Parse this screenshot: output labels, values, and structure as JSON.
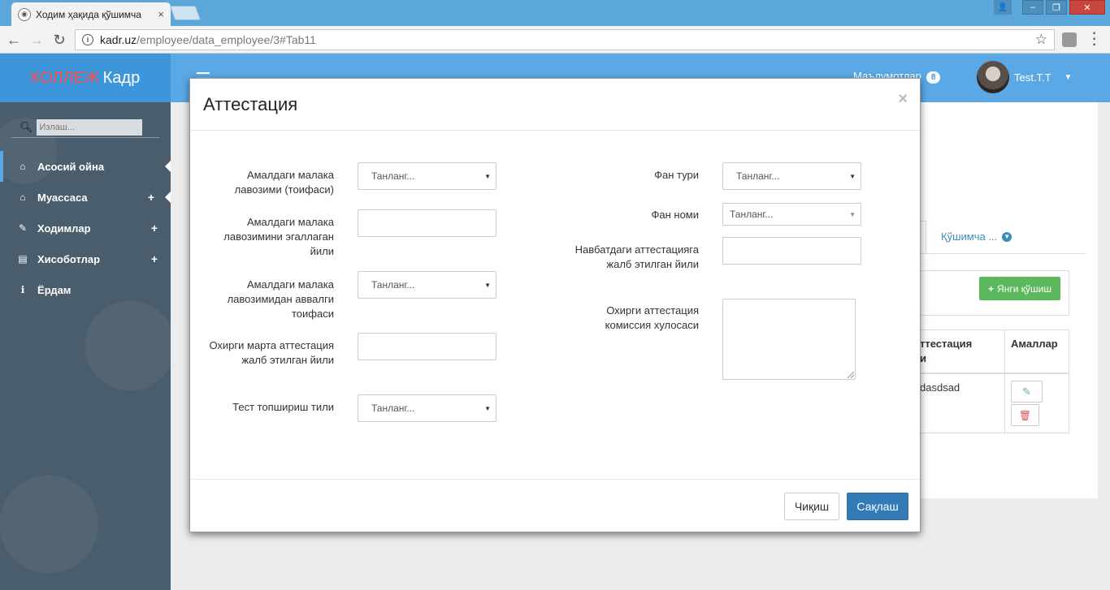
{
  "browser": {
    "tab_title": "Ходим ҳақида қўшимча",
    "url_host": "kadr.uz",
    "url_path": "/employee/data_employee/3#Tab11"
  },
  "header": {
    "logo_red": "КОЛЛЕЖ",
    "logo_white": "Кадр",
    "notifications_label": "Маълумотлар",
    "notifications_count": "8",
    "user_name": "Test.T.T"
  },
  "sidebar": {
    "search_placeholder": "Излаш...",
    "items": [
      {
        "label": "Асосий ойна",
        "icon": "home-icon"
      },
      {
        "label": "Муассаса",
        "icon": "home-icon"
      },
      {
        "label": "Ходимлар",
        "icon": "edit-icon"
      },
      {
        "label": "Хисоботлар",
        "icon": "table-icon"
      },
      {
        "label": "Ёрдам",
        "icon": "info-icon"
      }
    ]
  },
  "background": {
    "tab_more": "Қўшимча ...",
    "add_new": "Янги қўшиш",
    "col_attestation_1": "ттестация",
    "col_attestation_2": "и",
    "col_actions": "Амаллар",
    "cell_value": "dasdsad"
  },
  "modal": {
    "title": "Аттестация",
    "close": "×",
    "fields": {
      "current_qualification_label": "Амалдаги малака лавозими (тоифаси)",
      "current_qualification_value": "Танланг...",
      "year_obtained_label": "Амалдаги малака лавозимини эгаллаган йили",
      "previous_qualification_label": "Амалдаги малака лавозимидан аввалги тоифаси",
      "previous_qualification_value": "Танланг...",
      "last_attestation_year_label": "Охирги марта аттестация жалб этилган йили",
      "test_language_label": "Тест топшириш тили",
      "test_language_value": "Танланг...",
      "subject_type_label": "Фан тури",
      "subject_type_value": "Танланг...",
      "subject_name_label": "Фан номи",
      "subject_name_value": "Танланг...",
      "next_attestation_label": "Навбатдаги аттестацияга жалб этилган йили",
      "last_commission_label": "Охирги аттестация комиссия хулосаси"
    },
    "cancel": "Чиқиш",
    "save": "Сақлаш"
  }
}
